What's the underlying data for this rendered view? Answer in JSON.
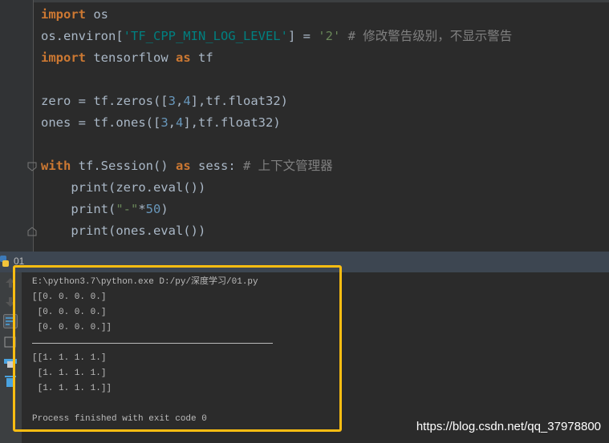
{
  "editor": {
    "lines": [
      [
        [
          "kw",
          "import"
        ],
        [
          "fn",
          " os"
        ]
      ],
      [
        [
          "fn",
          "os.environ["
        ],
        [
          "str",
          "'TF_CPP_MIN_LOG_LEVEL'"
        ],
        [
          "fn",
          "] = "
        ],
        [
          "strq",
          "'2'"
        ],
        [
          "cm",
          " # 修改警告级别，不显示警告"
        ]
      ],
      [
        [
          "kw",
          "import"
        ],
        [
          "fn",
          " tensorflow "
        ],
        [
          "kw",
          "as"
        ],
        [
          "fn",
          " tf"
        ]
      ],
      [],
      [
        [
          "fn",
          "zero = tf.zeros(["
        ],
        [
          "num",
          "3"
        ],
        [
          "fn",
          ","
        ],
        [
          "num",
          "4"
        ],
        [
          "fn",
          "],tf.float32)"
        ]
      ],
      [
        [
          "fn",
          "ones = tf.ones(["
        ],
        [
          "num",
          "3"
        ],
        [
          "fn",
          ","
        ],
        [
          "num",
          "4"
        ],
        [
          "fn",
          "],tf.float32)"
        ]
      ],
      [],
      [
        [
          "kw",
          "with"
        ],
        [
          "fn",
          " tf.Session() "
        ],
        [
          "kw",
          "as"
        ],
        [
          "fn",
          " sess: "
        ],
        [
          "cm",
          "# 上下文管理器"
        ]
      ],
      [
        [
          "fn",
          "    print(zero.eval())"
        ]
      ],
      [
        [
          "fn",
          "    print("
        ],
        [
          "strq",
          "\"-\""
        ],
        [
          "fn",
          "*"
        ],
        [
          "num",
          "50"
        ],
        [
          "fn",
          ")"
        ]
      ],
      [
        [
          "fn",
          "    print(ones.eval())"
        ]
      ]
    ]
  },
  "run_panel": {
    "tab_title": "01",
    "output": [
      "E:\\python3.7\\python.exe D:/py/深度学习/01.py",
      "[[0. 0. 0. 0.]",
      " [0. 0. 0. 0.]",
      " [0. 0. 0. 0.]]",
      "---",
      "[[1. 1. 1. 1.]",
      " [1. 1. 1. 1.]",
      " [1. 1. 1. 1.]]",
      "",
      "Process finished with exit code 0"
    ],
    "tools": [
      "arrow-up-icon",
      "arrow-down-icon",
      "soft-wrap-icon",
      "scroll-to-end-icon",
      "print-icon",
      "trash-icon"
    ]
  },
  "highlight_color": "#fbbd12",
  "watermark": "https://blog.csdn.net/qq_37978800"
}
